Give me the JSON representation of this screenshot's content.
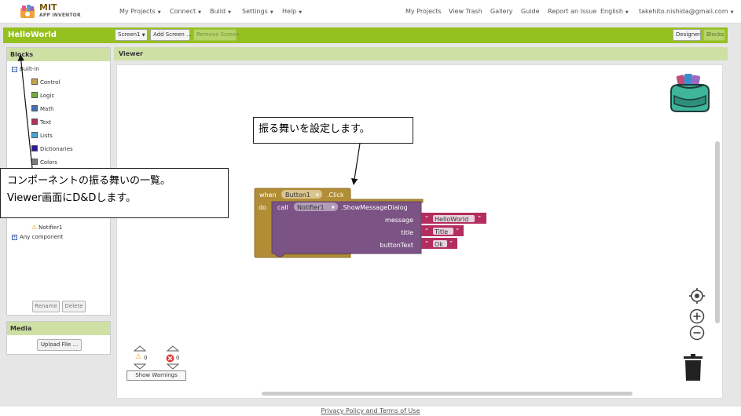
{
  "app": {
    "logo_title": "MIT",
    "logo_subtitle": "APP INVENTOR"
  },
  "topnav": {
    "left_menus": [
      "My Projects",
      "Connect",
      "Build",
      "Settings",
      "Help"
    ],
    "right_links": [
      "My Projects",
      "View Trash",
      "Gallery",
      "Guide",
      "Report an Issue"
    ],
    "language": "English",
    "account": "takehito.nishida@gmail.com"
  },
  "project": {
    "name": "HelloWorld",
    "screen_select": "Screen1",
    "add_screen": "Add Screen ...",
    "remove_screen": "Remove Screen",
    "designer": "Designer",
    "blocks": "Blocks"
  },
  "blocks_panel": {
    "title": "Blocks",
    "builtin": "Built-in",
    "builtin_items": [
      {
        "label": "Control",
        "color": "#c5a34a"
      },
      {
        "label": "Logic",
        "color": "#77ab41"
      },
      {
        "label": "Math",
        "color": "#3f71b5"
      },
      {
        "label": "Text",
        "color": "#b32d5e"
      },
      {
        "label": "Lists",
        "color": "#49a6d4"
      },
      {
        "label": "Dictionaries",
        "color": "#2d1799"
      },
      {
        "label": "Colors",
        "color": "#7d7d7d"
      }
    ],
    "component_item": "Notifier1",
    "any_component": "Any component",
    "rename": "Rename",
    "delete": "Delete"
  },
  "media_panel": {
    "title": "Media",
    "upload": "Upload File ..."
  },
  "viewer": {
    "title": "Viewer",
    "warnings_count": "0",
    "errors_count": "0",
    "show_warnings": "Show Warnings"
  },
  "block_event": {
    "when": "when",
    "component": "Button1",
    "event": ".Click",
    "do": "do"
  },
  "block_call": {
    "call": "call",
    "component": "Notifier1",
    "method": ".ShowMessageDialog",
    "params": [
      {
        "name": "message",
        "value": "HelloWorld"
      },
      {
        "name": "title",
        "value": "Title"
      },
      {
        "name": "buttonText",
        "value": "Ok"
      }
    ]
  },
  "annotations": {
    "callout_top": "振る舞いを設定します。",
    "callout_left_line1": "コンポーネントの振る舞いの一覧。",
    "callout_left_line2": "Viewer画面にD&Dします。"
  },
  "footer": {
    "link": "Privacy Policy and Terms of Use"
  },
  "colors": {
    "green_bar": "#95c11e",
    "panel_header": "#cfe0a5",
    "event_block": "#b18e35",
    "call_block": "#7c5385",
    "text_block": "#b32d5e"
  }
}
